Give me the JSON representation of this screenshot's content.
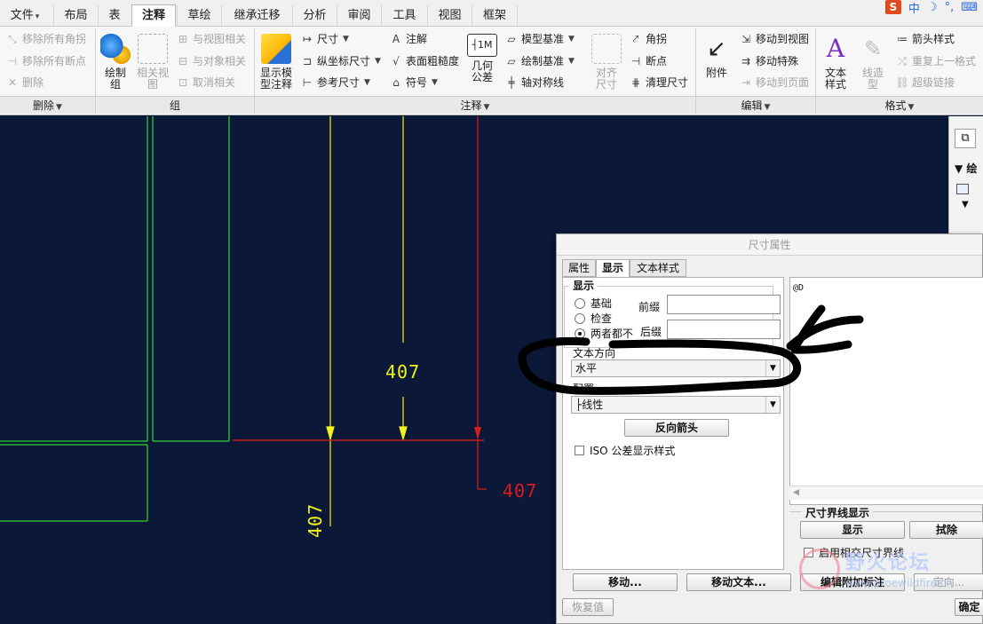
{
  "tabs": [
    {
      "label": "文件",
      "dd": "▾"
    },
    {
      "label": "布局"
    },
    {
      "label": "表"
    },
    {
      "label": "注释",
      "active": true
    },
    {
      "label": "草绘"
    },
    {
      "label": "继承迁移"
    },
    {
      "label": "分析"
    },
    {
      "label": "审阅"
    },
    {
      "label": "工具"
    },
    {
      "label": "视图"
    },
    {
      "label": "框架"
    }
  ],
  "ribbon": {
    "delete_group": {
      "title": "删除",
      "items": [
        "移除所有角拐",
        "移除所有断点",
        "删除"
      ]
    },
    "group_group": {
      "title": "组",
      "draw_group": "绘制\n组",
      "related_view": "相关视\n图",
      "items": [
        "与视图相关",
        "与对象相关",
        "取消相关"
      ]
    },
    "annotation_group": {
      "title": "注释",
      "show_model_annotation": "显示模\n型注释",
      "col1": [
        "尺寸",
        "纵坐标尺寸",
        "参考尺寸"
      ],
      "col2": [
        "注解",
        "表面粗糙度",
        "符号"
      ],
      "geo_tolerance": "几何\n公差",
      "col3": [
        "模型基准",
        "绘制基准",
        "轴对称线"
      ],
      "align_dim": "对齐\n尺寸",
      "col4": [
        "角拐",
        "断点",
        "清理尺寸"
      ]
    },
    "edit_group": {
      "title": "编辑",
      "attach": "附件",
      "items": [
        "移动到视图",
        "移动特殊",
        "移动到页面"
      ]
    },
    "format_group": {
      "title": "格式",
      "text_style": "文本\n样式",
      "line_style": "线造\n型",
      "items": [
        "箭头样式",
        "重复上一格式",
        "超级链接"
      ]
    }
  },
  "canvas": {
    "dim_vertical_label": "407",
    "dim_horizontal_label": "407",
    "dim_rotated_label": "407"
  },
  "side_panel": {
    "tree_label": "绘"
  },
  "dialog": {
    "title": "尺寸属性",
    "tabs": [
      "属性",
      "显示",
      "文本样式"
    ],
    "display_legend": "显示",
    "radios": [
      {
        "label": "基础",
        "checked": false
      },
      {
        "label": "检查",
        "checked": false
      },
      {
        "label": "两者都不",
        "checked": true
      }
    ],
    "prefix_label": "前缀",
    "suffix_label": "后缀",
    "text_direction_label": "文本方向",
    "text_direction_value": "水平",
    "config_label": "配置",
    "config_value": "线性",
    "reverse_arrow": "反向箭头",
    "iso_checkbox": "ISO 公差显示样式",
    "text_content": "@D",
    "extension_legend": "尺寸界线显示",
    "show_button": "显示",
    "erase_button": "拭除",
    "enable_intersect": "启用相交尺寸界线",
    "move_button": "移动...",
    "move_text_button": "移动文本...",
    "edit_attach_button": "编辑附加标注",
    "orient_button": "定向...",
    "restore_button": "恢复值",
    "ok_button": "确定"
  },
  "watermark": {
    "text": "野火论坛",
    "url": "www.proewildfire.cn"
  },
  "colors": {
    "canvas_bg": "#0b1838",
    "green_geometry": "#2fd52f",
    "yellow_dim": "#f2f21c",
    "red_dim": "#e01b1b"
  }
}
